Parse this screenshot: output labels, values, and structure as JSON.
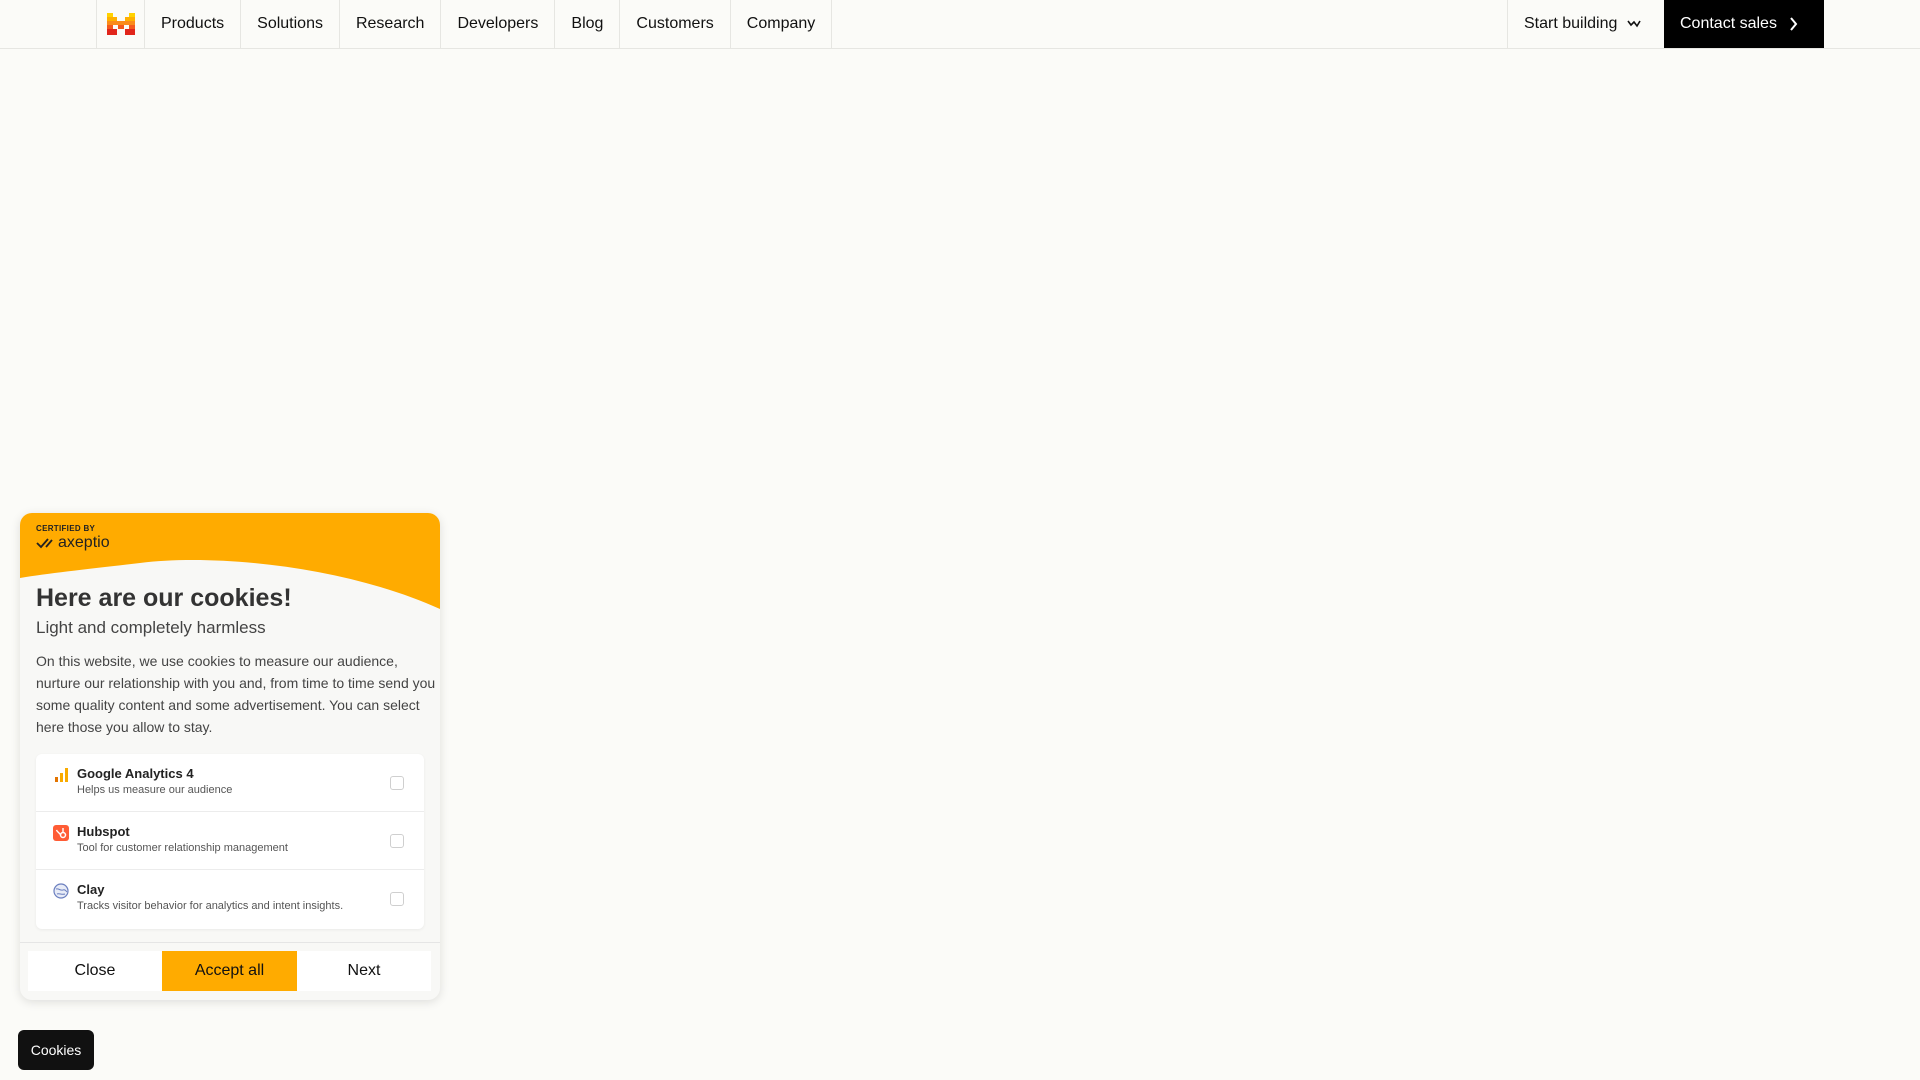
{
  "nav": {
    "items": [
      {
        "label": "Products",
        "name": "nav-item-products"
      },
      {
        "label": "Solutions",
        "name": "nav-item-solutions"
      },
      {
        "label": "Research",
        "name": "nav-item-research"
      },
      {
        "label": "Developers",
        "name": "nav-item-developers"
      },
      {
        "label": "Blog",
        "name": "nav-item-blog"
      },
      {
        "label": "Customers",
        "name": "nav-item-customers"
      },
      {
        "label": "Company",
        "name": "nav-item-company"
      }
    ],
    "start_building": "Start building",
    "contact_sales": "Contact sales"
  },
  "cookie_panel": {
    "certified_by": "CERTIFIED BY",
    "brand": "axeptio",
    "title": "Here are our cookies!",
    "subtitle": "Light and completely harmless",
    "description": "On this website, we use cookies to measure our audience, nurture our relationship with you and, from time to time send you some quality content and some advertisement. You can select here those you allow to stay.",
    "vendors": [
      {
        "name": "Google Analytics 4",
        "desc": "Helps us measure our audience",
        "icon": "analytics-bars-icon",
        "checked": false
      },
      {
        "name": "Hubspot",
        "desc": "Tool for customer relationship management",
        "icon": "hubspot-icon",
        "checked": false
      },
      {
        "name": "Clay",
        "desc": "Tracks visitor behavior for analytics and intent insights.",
        "icon": "clay-globe-icon",
        "checked": false
      }
    ],
    "buttons": {
      "close": "Close",
      "accept_all": "Accept all",
      "next": "Next"
    }
  },
  "cookies_button": "Cookies",
  "colors": {
    "background": "#fbfbf8",
    "accent": "#ffab00",
    "logo_orange": "#fa8b1a",
    "logo_red": "#e1251b",
    "cta": "#000000"
  }
}
